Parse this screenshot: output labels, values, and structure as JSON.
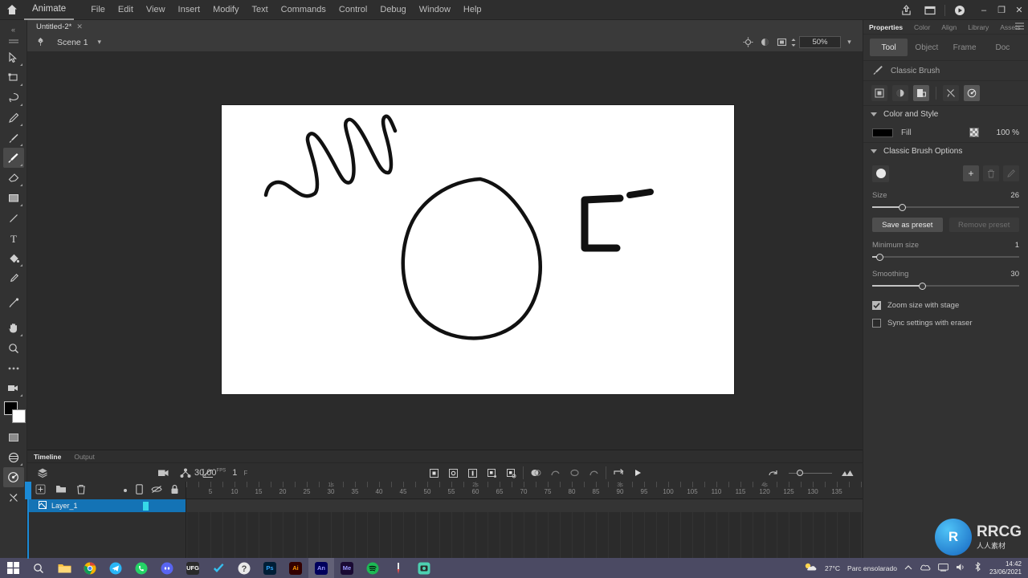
{
  "titlebar": {
    "app_label": "Animate",
    "home_icon": "home-icon",
    "menus": [
      "File",
      "Edit",
      "View",
      "Insert",
      "Modify",
      "Text",
      "Commands",
      "Control",
      "Debug",
      "Window",
      "Help"
    ],
    "right_icons": [
      "share-icon",
      "screen-icon",
      "play-circle-icon"
    ],
    "window_controls": {
      "minimize": "–",
      "maximize": "❐",
      "close": "✕"
    }
  },
  "doctab": {
    "name": "Untitled-2*",
    "close": "✕"
  },
  "toolbar": {
    "collapse_label": "«",
    "tools": [
      {
        "name": "selection-tool",
        "glyph": "selection"
      },
      {
        "name": "free-transform-tool",
        "glyph": "transform"
      },
      {
        "name": "lasso-tool",
        "glyph": "lasso"
      },
      {
        "name": "pen-tool",
        "glyph": "pen"
      },
      {
        "name": "paint-brush-tool",
        "glyph": "paintbrush"
      },
      {
        "name": "classic-brush-tool",
        "glyph": "brush"
      },
      {
        "name": "eraser-tool",
        "glyph": "eraser"
      },
      {
        "name": "rectangle-tool",
        "glyph": "rectangle"
      },
      {
        "name": "line-tool",
        "glyph": "line"
      },
      {
        "name": "text-tool",
        "glyph": "text"
      },
      {
        "name": "paint-bucket-tool",
        "glyph": "bucket"
      },
      {
        "name": "eyedropper-tool",
        "glyph": "eyedropper"
      },
      {
        "name": "width-tool",
        "glyph": "width"
      },
      {
        "name": "hand-tool",
        "glyph": "hand"
      },
      {
        "name": "zoom-tool",
        "glyph": "magnifier"
      },
      {
        "name": "more-tools",
        "glyph": "ellipsis"
      },
      {
        "name": "camera-tool",
        "glyph": "camera"
      }
    ],
    "bottom_tools": [
      {
        "name": "stage-color-tool",
        "glyph": "stage"
      },
      {
        "name": "layer-depth-tool",
        "glyph": "depth"
      },
      {
        "name": "asset-warp-tool",
        "glyph": "warp"
      },
      {
        "name": "bone-tool",
        "glyph": "bone"
      }
    ],
    "active_tool": "classic-brush-tool",
    "fill_color": "#000000",
    "stroke_color": "#ffffff"
  },
  "stagebar": {
    "scene_icon": "scene-icon",
    "scene_name": "Scene 1",
    "scene_caret": "▾",
    "icons": [
      "center-stage-icon",
      "rotate-icon",
      "clip-content-icon"
    ],
    "zoom_value": "50%",
    "zoom_caret": "▾"
  },
  "properties": {
    "tabs": [
      {
        "label": "Properties",
        "active": true
      },
      {
        "label": "Color",
        "active": false
      },
      {
        "label": "Align",
        "active": false
      },
      {
        "label": "Library",
        "active": false
      },
      {
        "label": "Assets",
        "active": false
      }
    ],
    "menu_icon": "panel-menu-icon",
    "segments": [
      {
        "label": "Tool",
        "active": true
      },
      {
        "label": "Object",
        "active": false
      },
      {
        "label": "Frame",
        "active": false
      },
      {
        "label": "Doc",
        "active": false
      }
    ],
    "tool_icon": "brush-icon",
    "tool_name": "Classic Brush",
    "mode_icons": [
      {
        "name": "draw-as-object-icon",
        "active": false
      },
      {
        "name": "paint-mode-icon",
        "active": false
      },
      {
        "name": "lock-fill-icon",
        "active": true
      },
      {
        "name": "snap-to-objects-icon",
        "active": false
      },
      {
        "name": "smooth-icon",
        "active": true
      }
    ],
    "color_section": {
      "title": "Color and Style",
      "fill_label": "Fill",
      "fill_color": "#000000",
      "alpha_icon": "transparency-icon",
      "alpha_value": "100 %"
    },
    "brush_section": {
      "title": "Classic Brush Options",
      "preset_icon": "brush-preset-icon",
      "add_preset_icon": "+",
      "delete_preset_icon": "trash-icon",
      "edit_preset_icon": "edit-icon",
      "size_label": "Size",
      "size_value": "26",
      "size_pct": 20,
      "save_preset_label": "Save as preset",
      "remove_preset_label": "Remove preset",
      "minimum_size_label": "Minimum size",
      "minimum_size_value": "1",
      "minimum_size_pct": 5,
      "smoothing_label": "Smoothing",
      "smoothing_value": "30",
      "smoothing_pct": 34,
      "zoom_with_stage_label": "Zoom size with stage",
      "zoom_with_stage_checked": true,
      "sync_eraser_label": "Sync settings with eraser",
      "sync_eraser_checked": false
    }
  },
  "timeline": {
    "tabs": [
      {
        "label": "Timeline",
        "active": true
      },
      {
        "label": "Output",
        "active": false
      }
    ],
    "left_icons": [
      "layer-parenting-icon"
    ],
    "mid_icons": [
      "camera-icon",
      "layer-depth-icon",
      "graph-editor-icon"
    ],
    "fps_value": "30,00",
    "fps_unit": "FPS",
    "current_frame": "1",
    "elapsed": "F",
    "center_icons": [
      "insert-keyframe-icon",
      "insert-blank-keyframe-icon",
      "insert-frame-icon",
      "create-motion-tween-icon",
      "create-shape-tween-icon",
      "onion-skin-icon",
      "onion-outline-icon",
      "edit-multiple-frames-icon",
      "modify-markers-icon",
      "loop-icon",
      "play-icon"
    ],
    "right_icons": [
      "resize-timeline-icon",
      "frame-view-icon"
    ],
    "layer_tools_left": [
      "add-layer-icon",
      "new-folder-icon",
      "delete-layer-icon"
    ],
    "layer_tools_right": [
      "parent-dot-icon",
      "show-all-icon",
      "eye-icon",
      "lock-icon"
    ],
    "layers": [
      {
        "name": "Layer_1",
        "selected": true,
        "keyframe_frame": 1
      }
    ],
    "ruler_ticks": [
      5,
      10,
      15,
      20,
      25,
      30,
      35,
      40,
      45,
      50,
      55,
      60,
      65,
      70,
      75,
      80,
      85,
      90,
      95,
      100,
      105,
      110,
      115,
      120,
      125,
      130,
      135
    ],
    "second_markers": [
      "1s",
      "2s",
      "3s",
      "4s"
    ]
  },
  "taskbar": {
    "items": [
      {
        "name": "start-button",
        "label": "⊞",
        "color": "#3a7bd5"
      },
      {
        "name": "search-button",
        "label": "⌕",
        "color": "transparent"
      },
      {
        "name": "file-explorer",
        "label": "",
        "color": "#ffbf3f"
      },
      {
        "name": "chrome",
        "label": "",
        "color": "#4caf50"
      },
      {
        "name": "telegram",
        "label": "",
        "color": "#29b6f6"
      },
      {
        "name": "whatsapp",
        "label": "",
        "color": "#25d366"
      },
      {
        "name": "discord",
        "label": "",
        "color": "#5865f2"
      },
      {
        "name": "epic-games",
        "label": "UFG",
        "color": "#2a2a2a"
      },
      {
        "name": "todo-app",
        "label": "✔",
        "color": "#2e88d6"
      },
      {
        "name": "unknown-app",
        "label": "?",
        "color": "#e8e8e8"
      },
      {
        "name": "photoshop",
        "label": "Ps",
        "color": "#001e36"
      },
      {
        "name": "illustrator",
        "label": "Ai",
        "color": "#330000"
      },
      {
        "name": "animate",
        "label": "An",
        "color": "#2a1e5c"
      },
      {
        "name": "media-encoder",
        "label": "Me",
        "color": "#1a0a33"
      },
      {
        "name": "spotify",
        "label": "",
        "color": "#1db954"
      },
      {
        "name": "paint-app",
        "label": "",
        "color": "#d94f4f"
      },
      {
        "name": "camera-app",
        "label": "",
        "color": "#4dd0b1"
      }
    ],
    "active_item": "animate",
    "tray": {
      "weather_temp": "27°C",
      "weather_desc": "Parc ensolarado",
      "icons": [
        "chevron-up-icon",
        "onedrive-icon",
        "network-icon",
        "volume-icon",
        "bluetooth-icon"
      ],
      "time": "14:42",
      "date": "23/06/2021"
    }
  },
  "watermarks": {
    "brand": "RRCG",
    "brand_cn": "人人素材",
    "badge_letter": "R",
    "badge_text": "RRCG",
    "badge_sub": "人人素材"
  }
}
